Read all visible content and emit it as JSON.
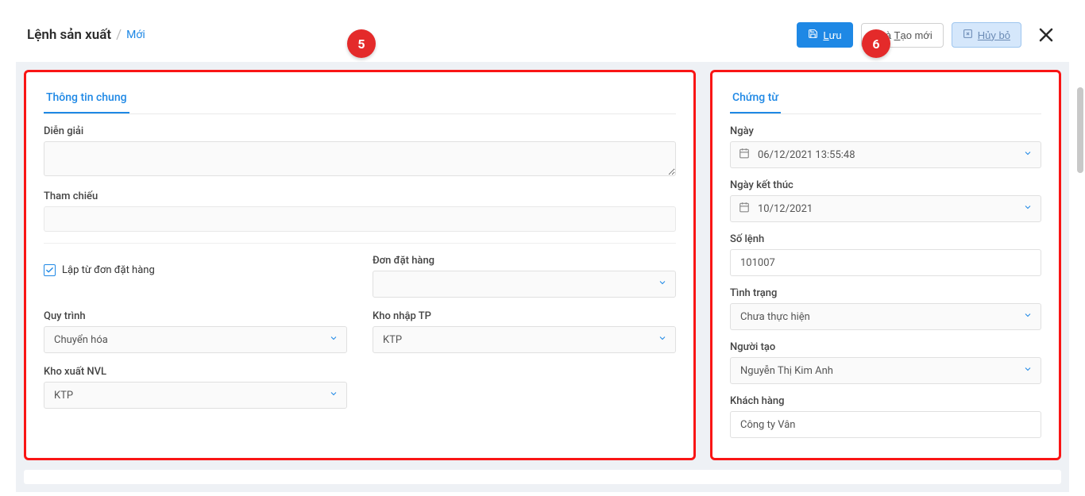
{
  "breadcrumb": {
    "title": "Lệnh sản xuất",
    "current": "Mới"
  },
  "toolbar": {
    "save": "Lưu",
    "save_new_prefix": "u và ",
    "save_new_suffix": "ạo mới",
    "save_new_u": "T",
    "cancel": "Hủy bỏ"
  },
  "badges": {
    "left": "5",
    "right": "6"
  },
  "left_panel": {
    "tab": "Thông tin chung",
    "fields": {
      "description_label": "Diễn giải",
      "reference_label": "Tham chiếu",
      "from_order_label": "Lập từ đơn đặt hàng",
      "order_label": "Đơn đặt hàng",
      "process_label": "Quy trình",
      "process_value": "Chuyển hóa",
      "warehouse_in_label": "Kho nhập TP",
      "warehouse_in_value": "KTP",
      "warehouse_out_label": "Kho xuất NVL",
      "warehouse_out_value": "KTP"
    }
  },
  "right_panel": {
    "tab": "Chứng từ",
    "fields": {
      "date_label": "Ngày",
      "date_value": "06/12/2021 13:55:48",
      "end_date_label": "Ngày kết thúc",
      "end_date_value": "10/12/2021",
      "order_no_label": "Số lệnh",
      "order_no_value": "101007",
      "status_label": "Tình trạng",
      "status_value": "Chưa thực hiện",
      "creator_label": "Người tạo",
      "creator_value": "Nguyễn Thị Kim Anh",
      "customer_label": "Khách hàng",
      "customer_value": "Công ty Vân"
    }
  }
}
